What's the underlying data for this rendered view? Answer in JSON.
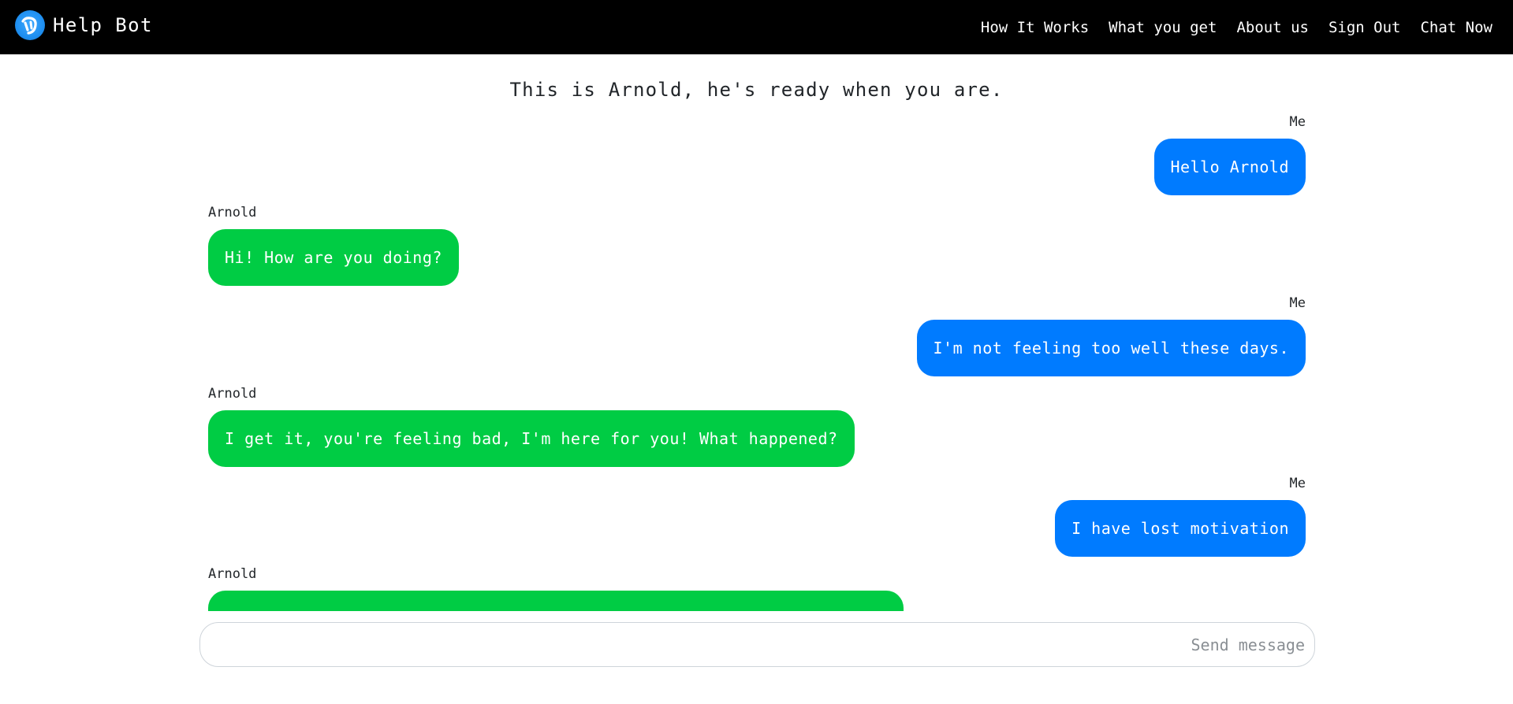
{
  "brand": {
    "name": "Help Bot",
    "logo_icon": "help-bot-logo-icon"
  },
  "nav": {
    "items": [
      {
        "label": "How It Works"
      },
      {
        "label": "What you get"
      },
      {
        "label": "About us"
      },
      {
        "label": "Sign Out"
      },
      {
        "label": "Chat Now"
      }
    ]
  },
  "intro": "This is Arnold, he's ready when you are.",
  "chat": {
    "messages": [
      {
        "sender": "Me",
        "text": "Hello Arnold"
      },
      {
        "sender": "Arnold",
        "text": "Hi! How are you doing?"
      },
      {
        "sender": "Me",
        "text": "I'm not feeling too well these days."
      },
      {
        "sender": "Arnold",
        "text": "I get it, you're feeling bad, I'm here for you! What happened?"
      },
      {
        "sender": "Me",
        "text": "I have lost motivation"
      },
      {
        "sender": "Arnold",
        "text": ""
      }
    ]
  },
  "composer": {
    "placeholder": "Send message",
    "value": ""
  },
  "colors": {
    "navbar": "#000000",
    "me_bubble": "#007bff",
    "bot_bubble": "#00cc44",
    "logo": "#1f8ff0"
  }
}
